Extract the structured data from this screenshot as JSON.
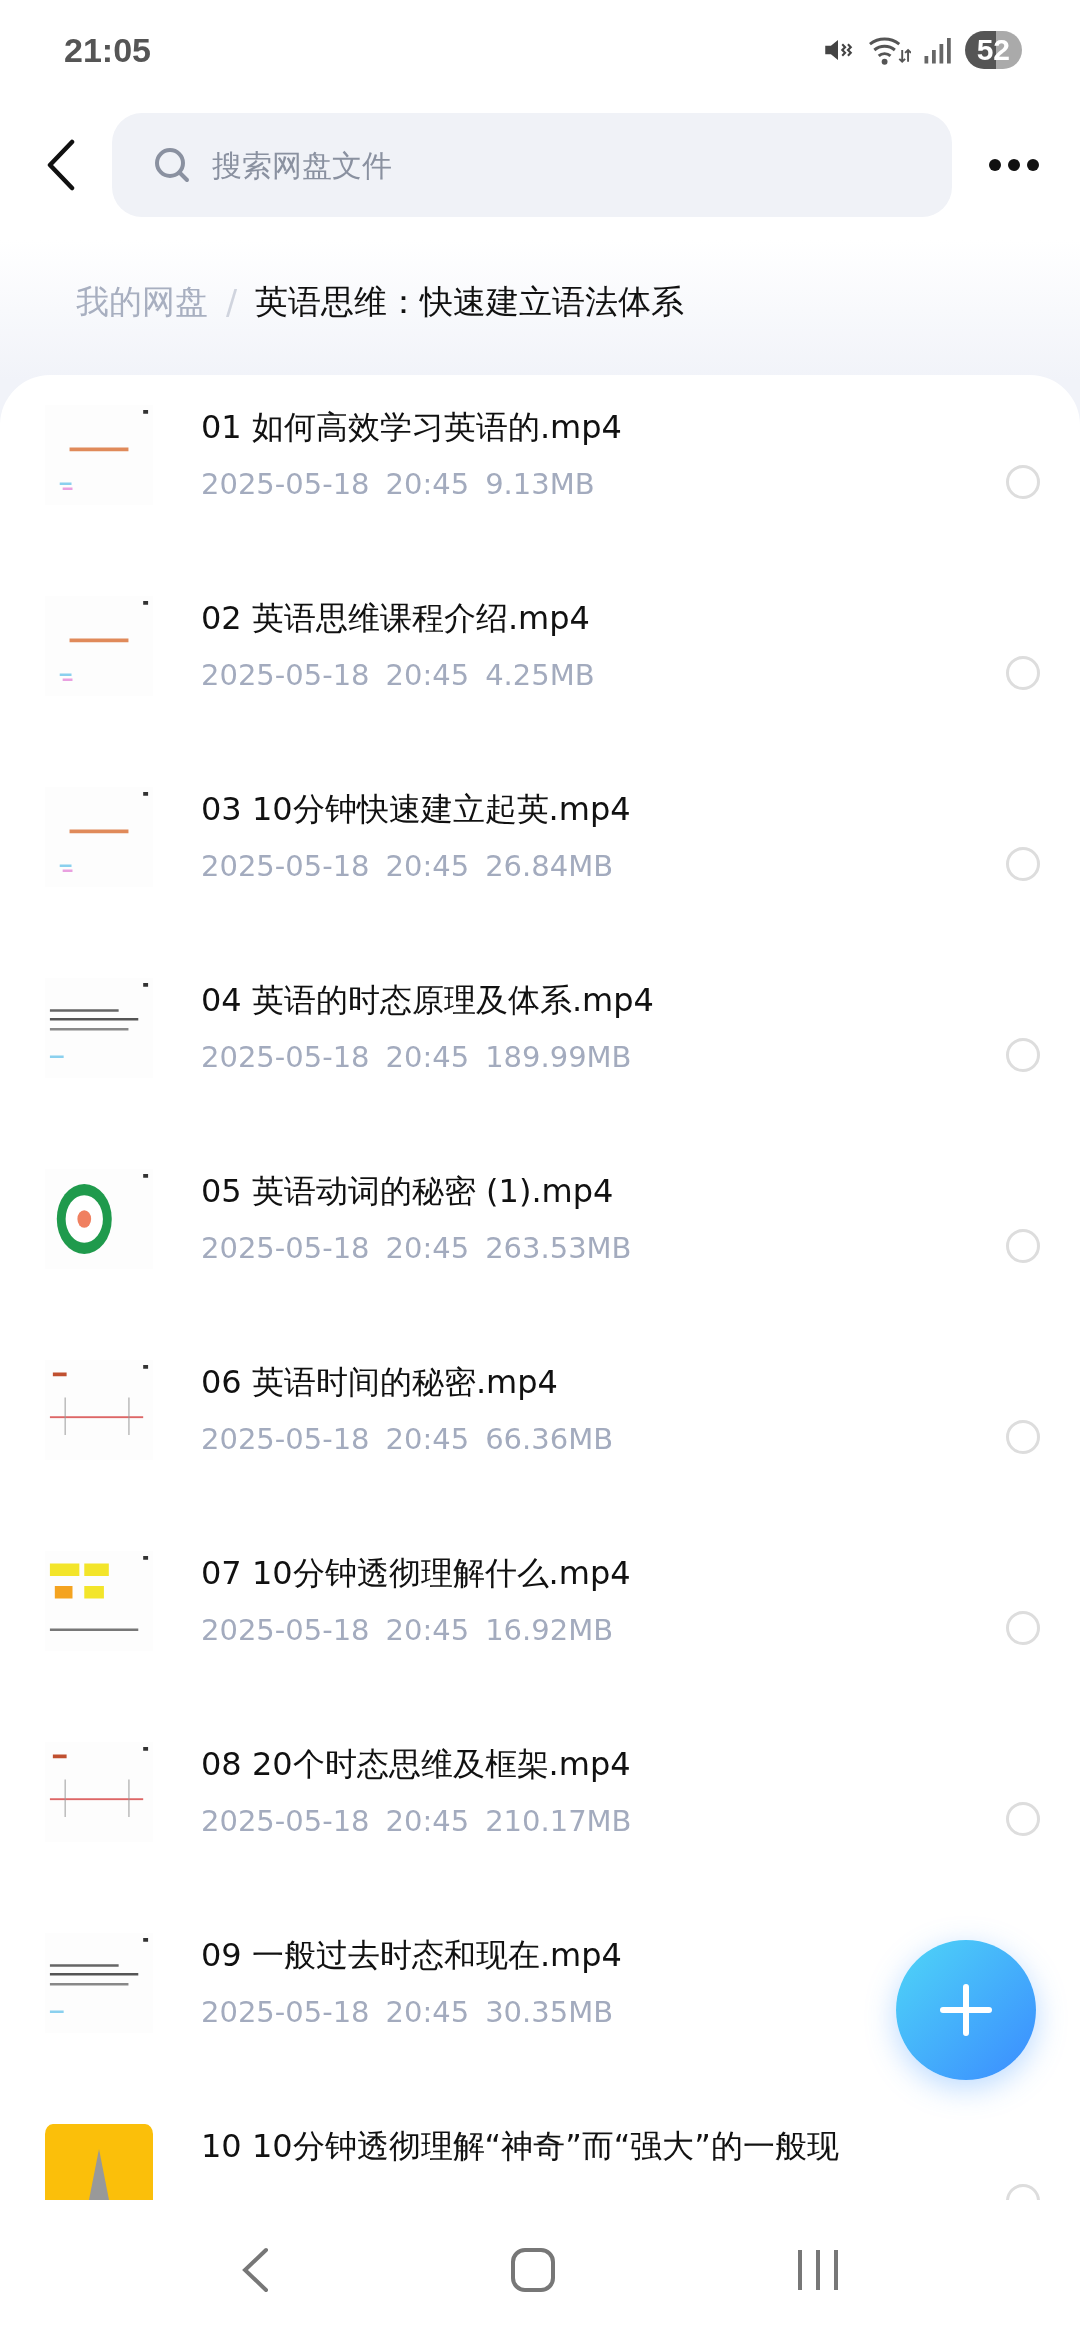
{
  "status_bar": {
    "time": "21:05",
    "battery": "52"
  },
  "search": {
    "placeholder": "搜索网盘文件"
  },
  "breadcrumb_separator": "/",
  "breadcrumb": [
    {
      "label": "我的网盘",
      "selected": false
    },
    {
      "label": "英语思维：快速建立语法体系",
      "selected": true
    }
  ],
  "files": [
    {
      "name": "01 如何高效学习英语的.mp4",
      "date": "2025-05-18",
      "time": "20:45",
      "size": "9.13MB",
      "checked": false
    },
    {
      "name": "02 英语思维课程介绍.mp4",
      "date": "2025-05-18",
      "time": "20:45",
      "size": "4.25MB",
      "checked": false
    },
    {
      "name": "03 10分钟快速建立起英.mp4",
      "date": "2025-05-18",
      "time": "20:45",
      "size": "26.84MB",
      "checked": false
    },
    {
      "name": "04 英语的时态原理及体系.mp4",
      "date": "2025-05-18",
      "time": "20:45",
      "size": "189.99MB",
      "checked": false
    },
    {
      "name": "05 英语动词的秘密 (1).mp4",
      "date": "2025-05-18",
      "time": "20:45",
      "size": "263.53MB",
      "checked": false
    },
    {
      "name": "06 英语时间的秘密.mp4",
      "date": "2025-05-18",
      "time": "20:45",
      "size": "66.36MB",
      "checked": false
    },
    {
      "name": "07 10分钟透彻理解什么.mp4",
      "date": "2025-05-18",
      "time": "20:45",
      "size": "16.92MB",
      "checked": false
    },
    {
      "name": "08 20个时态思维及框架.mp4",
      "date": "2025-05-18",
      "time": "20:45",
      "size": "210.17MB",
      "checked": false
    },
    {
      "name": "09 一般过去时态和现在.mp4",
      "date": "2025-05-18",
      "time": "20:45",
      "size": "30.35MB"
    },
    {
      "name": "10 10分钟透彻理解“神奇”而“强大”的一般现",
      "checked": false
    }
  ]
}
